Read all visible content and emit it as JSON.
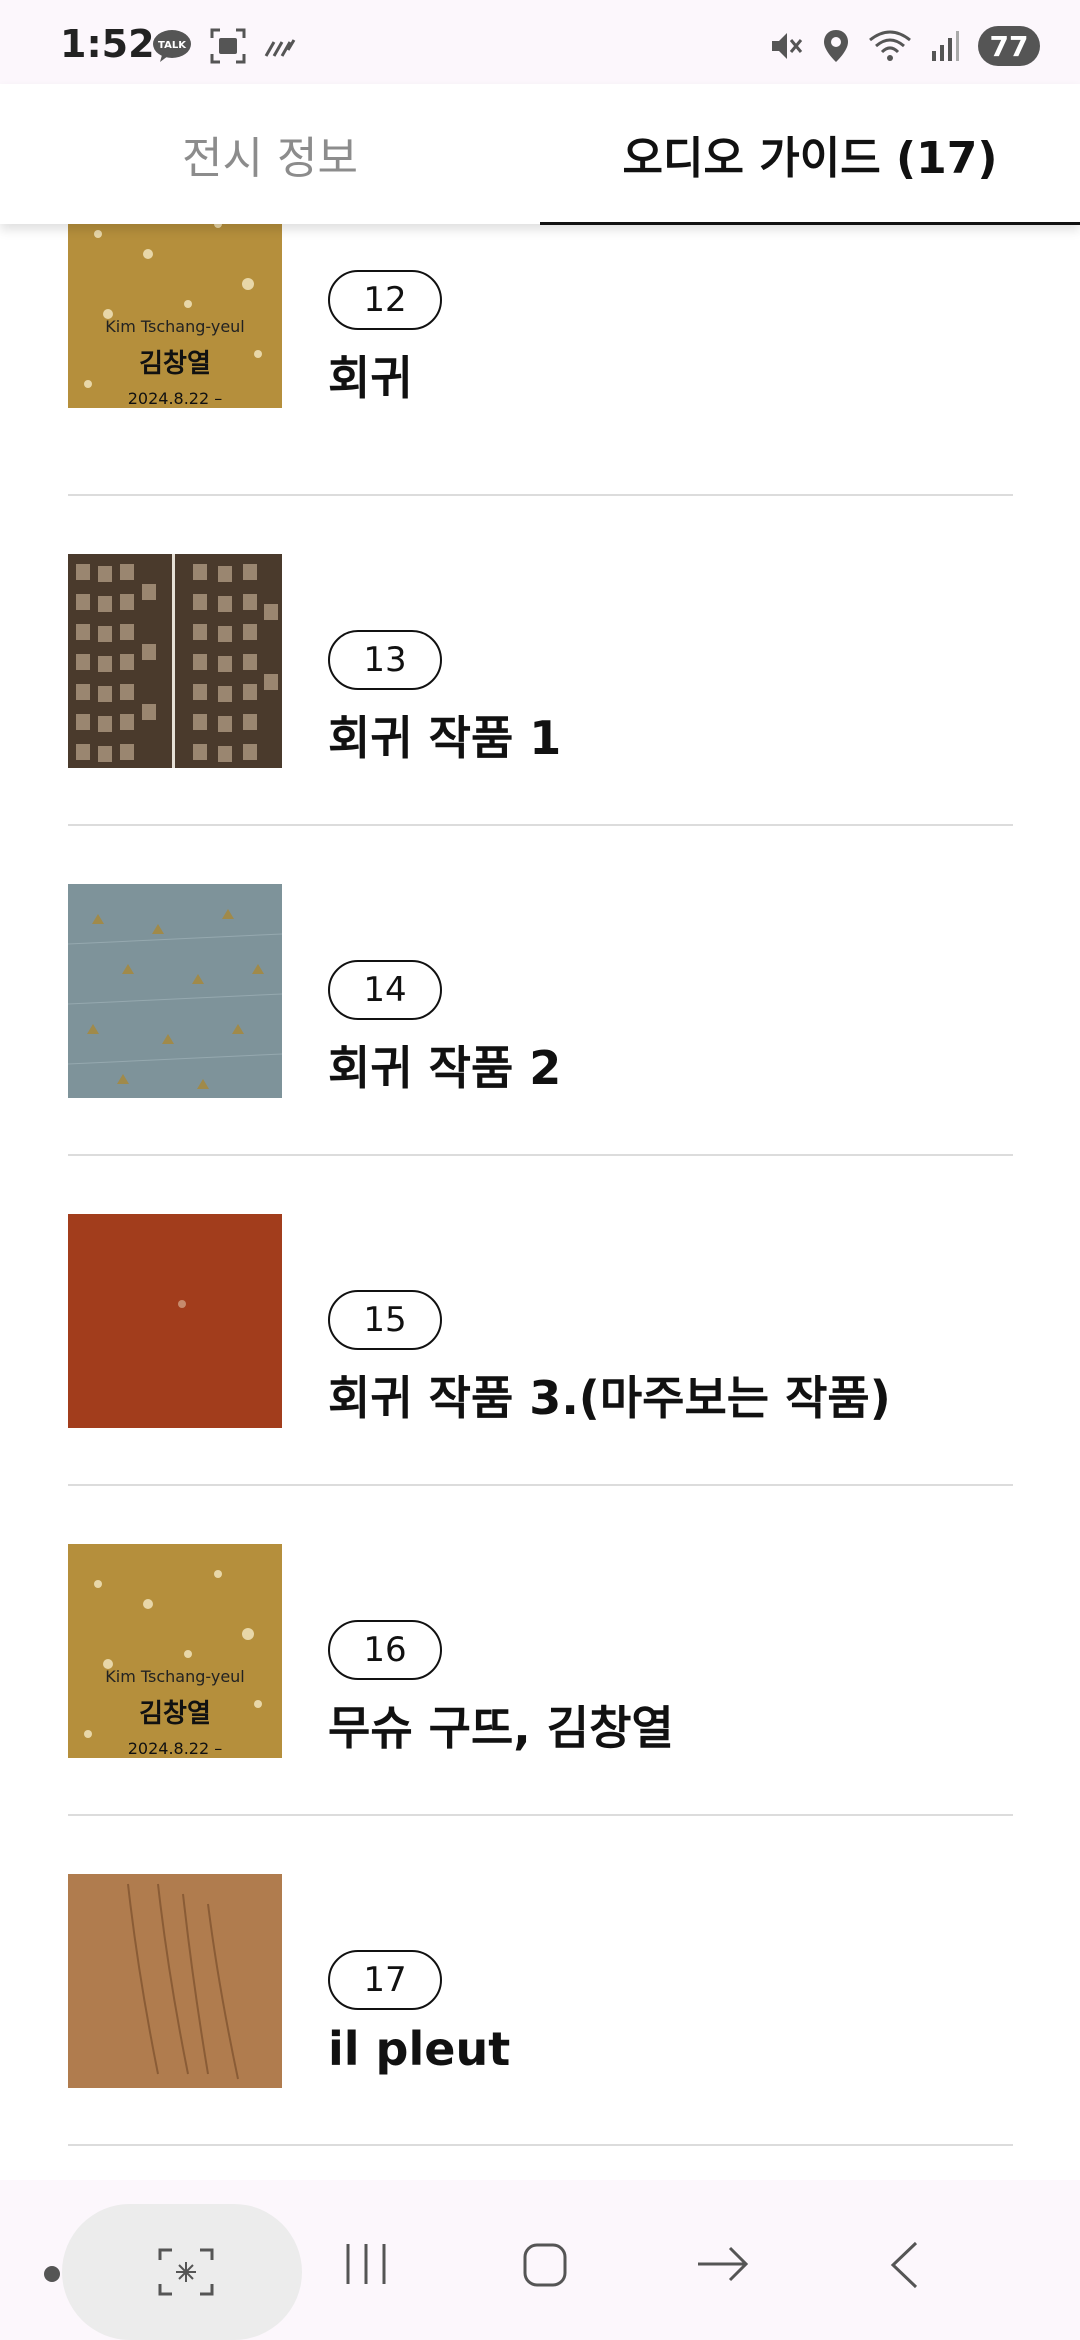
{
  "status_bar": {
    "time": "1:52",
    "battery": "77",
    "icons": [
      "talk-icon",
      "screenshot-icon",
      "signal-lines-icon",
      "mute-icon",
      "location-icon",
      "wifi-icon",
      "cell-signal-icon"
    ]
  },
  "tabs": [
    {
      "label": "전시 정보",
      "active": false
    },
    {
      "label": "오디오 가이드 (17)",
      "active": true
    }
  ],
  "items": [
    {
      "number": "12",
      "title": "회귀"
    },
    {
      "number": "13",
      "title": "회귀 작품 1"
    },
    {
      "number": "14",
      "title": "회귀 작품 2"
    },
    {
      "number": "15",
      "title": "회귀 작품 3.(마주보는 작품)"
    },
    {
      "number": "16",
      "title": "무슈 구뜨, 김창열"
    },
    {
      "number": "17",
      "title": "il pleut"
    }
  ],
  "poster_text": {
    "name_en": "Kim Tschang-yeul",
    "name_ko": "김창열",
    "date": "2024.8.22 –"
  },
  "nav_bar": {
    "icons": [
      "capture-icon",
      "recents-icon",
      "home-icon",
      "forward-icon",
      "back-icon"
    ]
  }
}
